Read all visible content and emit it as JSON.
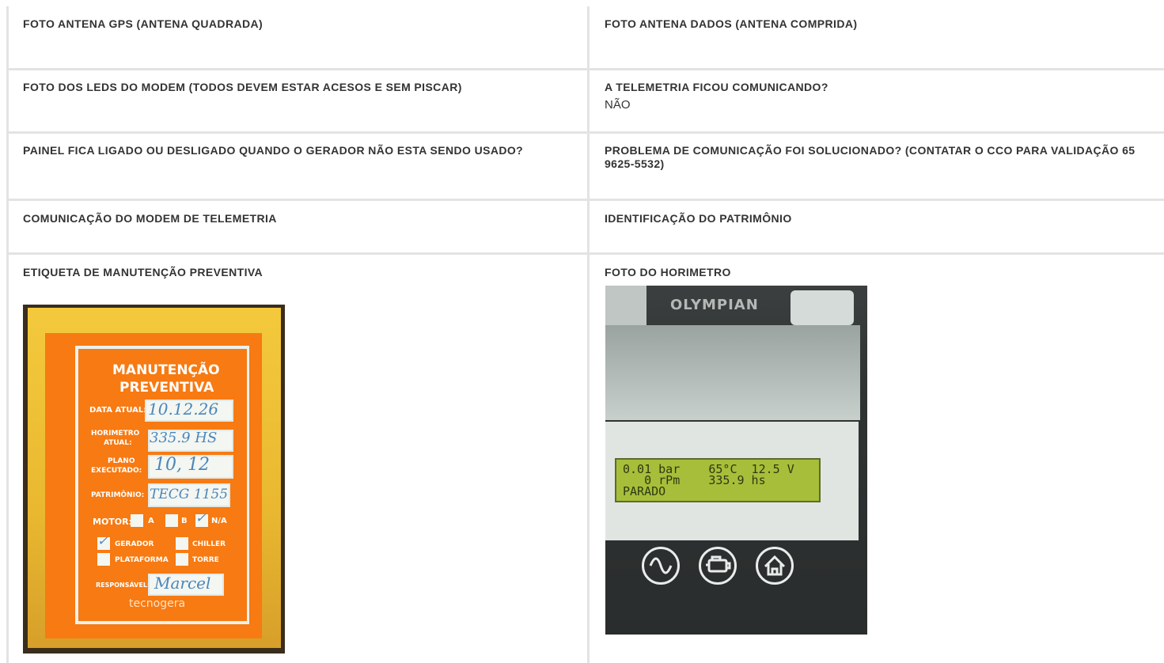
{
  "rows": [
    {
      "left": {
        "question": "FOTO ANTENA GPS (ANTENA QUADRADA)"
      },
      "right": {
        "question": "FOTO ANTENA DADOS (ANTENA COMPRIDA)"
      }
    },
    {
      "left": {
        "question": "FOTO DOS LEDS DO MODEM (TODOS DEVEM ESTAR ACESOS E SEM PISCAR)"
      },
      "right": {
        "question": "A TELEMETRIA FICOU COMUNICANDO?",
        "answer": "NÃO"
      }
    },
    {
      "left": {
        "question": "PAINEL FICA LIGADO OU DESLIGADO QUANDO O GERADOR NÃO ESTA SENDO USADO?"
      },
      "right": {
        "question": "PROBLEMA DE COMUNICAÇÃO FOI SOLUCIONADO? (CONTATAR O CCO PARA VALIDAÇÃO 65 9625-5532)"
      }
    },
    {
      "left": {
        "question": "COMUNICAÇÃO DO MODEM DE TELEMETRIA"
      },
      "right": {
        "question": "IDENTIFICAÇÃO DO PATRIMÔNIO"
      }
    },
    {
      "left": {
        "question": "ETIQUETA DE MANUTENÇÃO PREVENTIVA"
      },
      "right": {
        "question": "FOTO DO HORIMETRO"
      }
    }
  ],
  "maintenance_photo": {
    "title_line1": "MANUTENÇÃO",
    "title_line2": "PREVENTIVA",
    "data_atual_label": "DATA ATUAL:",
    "data_atual_value": "10.12.26",
    "horimetro_label_1": "HORIMETRO",
    "horimetro_label_2": "ATUAL:",
    "horimetro_value": "335.9 HS",
    "plano_label_1": "PLANO",
    "plano_label_2": "EXECUTADO:",
    "plano_value": "10, 12",
    "patrimonio_label": "PATRIMÔNIO:",
    "patrimonio_value": "TECG 1155",
    "motor_label": "MOTOR:",
    "opt_a": "A",
    "opt_b": "B",
    "opt_na": "N/A",
    "opt_gerador": "GERADOR",
    "opt_chiller": "CHILLER",
    "opt_plataforma": "PLATAFORMA",
    "opt_torre": "TORRE",
    "responsavel_label": "RESPONSÁVEL:",
    "responsavel_value": "Marcel",
    "brand": "tecnogera",
    "check_mark": "✓"
  },
  "hourmeter_photo": {
    "brand": "OLYMPIAN",
    "lcd_line1": "0.01 bar    65°C  12.5 V",
    "lcd_line2": "   0 rPm    335.9 hs",
    "lcd_line3": "PARADO"
  },
  "icons": {
    "sine": "sine-wave-icon",
    "engine": "engine-icon",
    "home": "home-icon"
  }
}
